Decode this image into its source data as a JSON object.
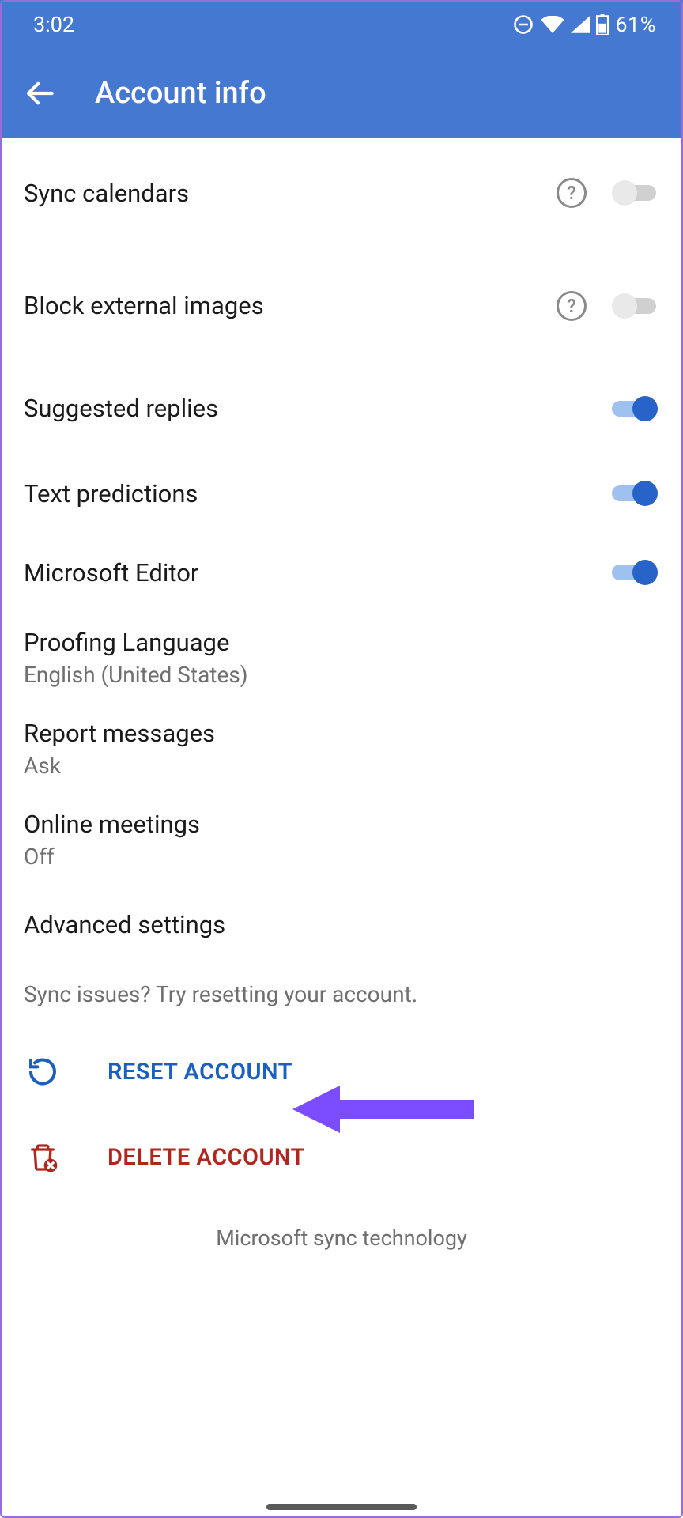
{
  "colors": {
    "primary": "#4478d1",
    "accent": "#2864c7",
    "danger": "#b3261e",
    "annotation": "#7c4dff"
  },
  "status": {
    "time": "3:02",
    "battery_pct": "61%"
  },
  "header": {
    "title": "Account info"
  },
  "settings": {
    "sync_calendars": {
      "label": "Sync calendars",
      "on": false,
      "help": true
    },
    "block_external_images": {
      "label": "Block external images",
      "on": false,
      "help": true
    },
    "suggested_replies": {
      "label": "Suggested replies",
      "on": true
    },
    "text_predictions": {
      "label": "Text predictions",
      "on": true
    },
    "microsoft_editor": {
      "label": "Microsoft Editor",
      "on": true
    },
    "proofing_language": {
      "label": "Proofing Language",
      "value": "English (United States)"
    },
    "report_messages": {
      "label": "Report messages",
      "value": "Ask"
    },
    "online_meetings": {
      "label": "Online meetings",
      "value": "Off"
    },
    "advanced": {
      "label": "Advanced settings"
    }
  },
  "hint": "Sync issues? Try resetting your account.",
  "actions": {
    "reset": "RESET ACCOUNT",
    "delete": "DELETE ACCOUNT"
  },
  "footer": "Microsoft sync technology"
}
